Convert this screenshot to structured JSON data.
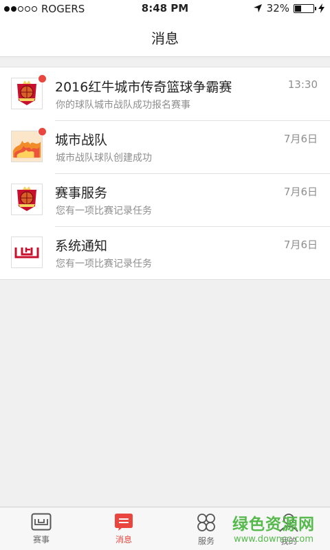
{
  "status_bar": {
    "carrier": "ROGERS",
    "time": "8:48 PM",
    "battery": "32%",
    "battery_level": 0.32,
    "signal_bars_filled": 2,
    "signal_bars_total": 5
  },
  "header": {
    "title": "消息"
  },
  "messages": [
    {
      "title": "2016红牛城市传奇篮球争霸赛",
      "subtitle": "你的球队城市战队成功报名赛事",
      "time": "13:30",
      "unread": true,
      "avatar_icon": "redbull-basketball-logo"
    },
    {
      "title": "城市战队",
      "subtitle": "城市战队球队创建成功",
      "time": "7月6日",
      "unread": true,
      "avatar_icon": "flame-team-avatar"
    },
    {
      "title": "赛事服务",
      "subtitle": "您有一项比赛记录任务",
      "time": "7月6日",
      "unread": false,
      "avatar_icon": "redbull-basketball-logo"
    },
    {
      "title": "系统通知",
      "subtitle": "您有一项比赛记录任务",
      "time": "7月6日",
      "unread": false,
      "avatar_icon": "app-logo"
    }
  ],
  "tabbar": {
    "items": [
      {
        "label": "赛事",
        "icon": "events-icon",
        "active": false
      },
      {
        "label": "消息",
        "icon": "message-icon",
        "active": true
      },
      {
        "label": "服务",
        "icon": "services-icon",
        "active": false
      },
      {
        "label": "我的",
        "icon": "profile-icon",
        "active": false
      }
    ]
  },
  "watermark": {
    "text": "绿色资源网",
    "url": "www.downcc.com"
  },
  "colors": {
    "accent": "#e8463e",
    "watermark": "#55b94b"
  }
}
